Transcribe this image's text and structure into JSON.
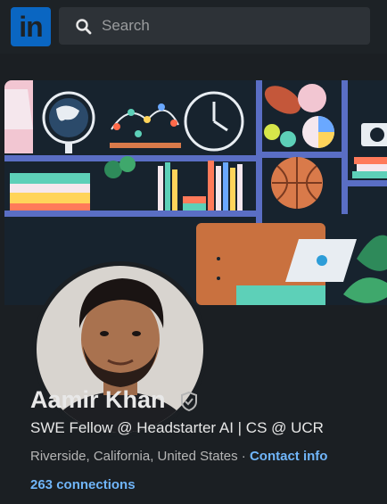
{
  "nav": {
    "logo_text": "in",
    "search": {
      "placeholder": "Search",
      "value": ""
    }
  },
  "profile": {
    "name": "Aamir Khan",
    "headline": "SWE Fellow @ Headstarter AI | CS @ UCR",
    "location": "Riverside, California, United States",
    "separator": "·",
    "contact_label": "Contact info",
    "connections_label": "263 connections"
  },
  "icons": {
    "logo": "linkedin-logo",
    "search": "search-icon",
    "verified": "shield-check-icon"
  },
  "colors": {
    "brand": "#0a66c2",
    "link": "#70b5f9",
    "background": "#1b1f23",
    "nav": "#1d2226"
  }
}
